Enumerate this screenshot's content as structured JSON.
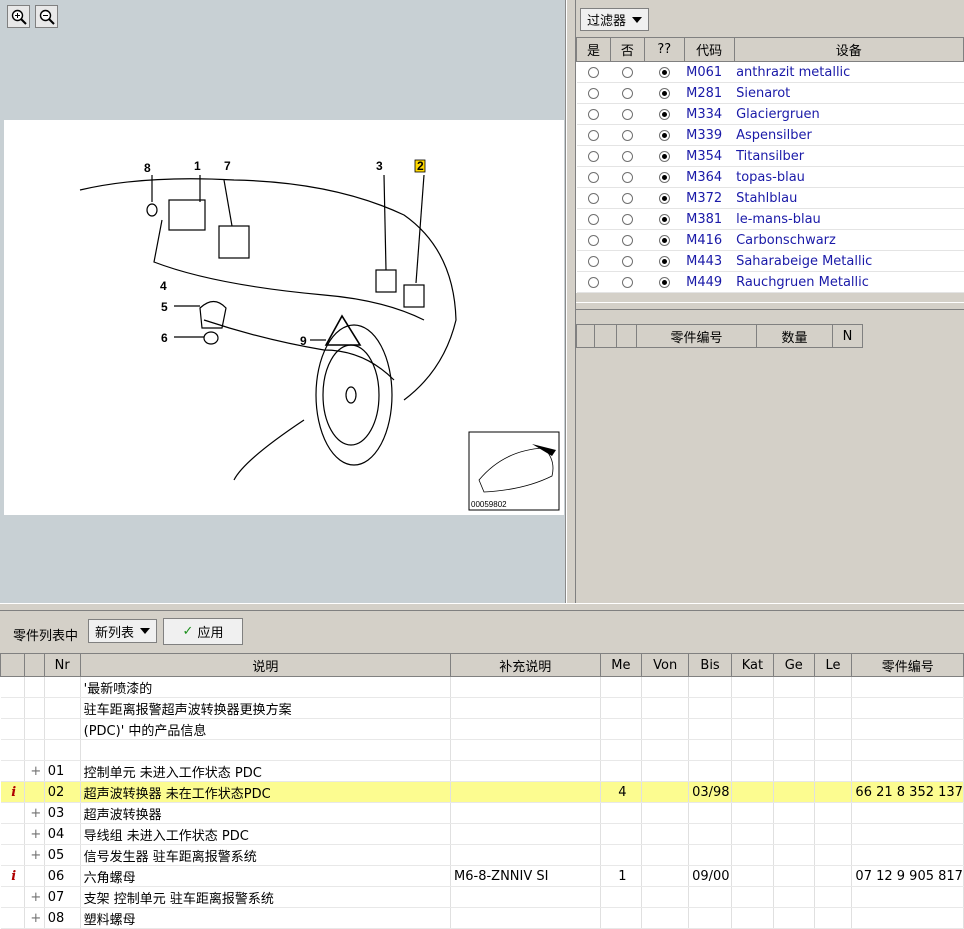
{
  "toolbar": {
    "zoom_in_icon": "magnifier-plus-icon",
    "zoom_out_icon": "magnifier-minus-icon"
  },
  "diagram": {
    "callouts": [
      "8",
      "1",
      "7",
      "3",
      "2",
      "4",
      "5",
      "6",
      "9"
    ],
    "thumb_code": "00059802"
  },
  "filter": {
    "button_label": "过滤器",
    "headers": {
      "yes": "是",
      "no": "否",
      "unknown": "??",
      "code": "代码",
      "equipment": "设备"
    },
    "rows": [
      {
        "code": "M061",
        "name": "anthrazit metallic"
      },
      {
        "code": "M281",
        "name": "Sienarot"
      },
      {
        "code": "M334",
        "name": "Glaciergruen"
      },
      {
        "code": "M339",
        "name": "Aspensilber"
      },
      {
        "code": "M354",
        "name": "Titansilber"
      },
      {
        "code": "M364",
        "name": "topas-blau"
      },
      {
        "code": "M372",
        "name": "Stahlblau"
      },
      {
        "code": "M381",
        "name": "le-mans-blau"
      },
      {
        "code": "M416",
        "name": "Carbonschwarz"
      },
      {
        "code": "M443",
        "name": "Saharabeige Metallic"
      },
      {
        "code": "M449",
        "name": "Rauchgruen Metallic"
      }
    ]
  },
  "mini_parts": {
    "headers": {
      "part_no": "零件编号",
      "qty": "数量",
      "n": "N"
    }
  },
  "bottom": {
    "label": "零件列表中",
    "list_select": "新列表",
    "apply_label": "应用"
  },
  "parts": {
    "headers": {
      "nr": "Nr",
      "desc": "说明",
      "extra": "补充说明",
      "me": "Me",
      "von": "Von",
      "bis": "Bis",
      "kat": "Kat",
      "ge": "Ge",
      "le": "Le",
      "part_no": "零件编号"
    },
    "rows": [
      {
        "icon": "",
        "nr": "",
        "desc": "'最新喷漆的",
        "extra": "",
        "me": "",
        "bis": "",
        "part_no": ""
      },
      {
        "icon": "",
        "nr": "",
        "desc": "驻车距离报警超声波转换器更换方案",
        "extra": "",
        "me": "",
        "bis": "",
        "part_no": ""
      },
      {
        "icon": "",
        "nr": "",
        "desc": "(PDC)' 中的产品信息",
        "extra": "",
        "me": "",
        "bis": "",
        "part_no": ""
      },
      {
        "icon": "",
        "nr": "",
        "desc": "",
        "extra": "",
        "me": "",
        "bis": "",
        "part_no": ""
      },
      {
        "icon": "plus",
        "nr": "01",
        "desc": "控制单元 未进入工作状态 PDC",
        "extra": "",
        "me": "",
        "bis": "",
        "part_no": ""
      },
      {
        "icon": "info",
        "nr": "02",
        "desc": "超声波转换器 未在工作状态PDC",
        "extra": "",
        "me": "4",
        "bis": "03/98",
        "part_no": "66 21 8 352 137",
        "highlight": true
      },
      {
        "icon": "plus",
        "nr": "03",
        "desc": "超声波转换器",
        "extra": "",
        "me": "",
        "bis": "",
        "part_no": ""
      },
      {
        "icon": "plus",
        "nr": "04",
        "desc": "导线组 未进入工作状态 PDC",
        "extra": "",
        "me": "",
        "bis": "",
        "part_no": ""
      },
      {
        "icon": "plus",
        "nr": "05",
        "desc": "信号发生器 驻车距离报警系统",
        "extra": "",
        "me": "",
        "bis": "",
        "part_no": ""
      },
      {
        "icon": "info",
        "nr": "06",
        "desc": "六角螺母",
        "extra": "M6-8-ZNNIV SI",
        "me": "1",
        "bis": "09/00",
        "part_no": "07 12 9 905 817"
      },
      {
        "icon": "plus",
        "nr": "07",
        "desc": "支架 控制单元 驻车距离报警系统",
        "extra": "",
        "me": "",
        "bis": "",
        "part_no": ""
      },
      {
        "icon": "plus",
        "nr": "08",
        "desc": "塑料螺母",
        "extra": "",
        "me": "",
        "bis": "",
        "part_no": ""
      }
    ]
  }
}
